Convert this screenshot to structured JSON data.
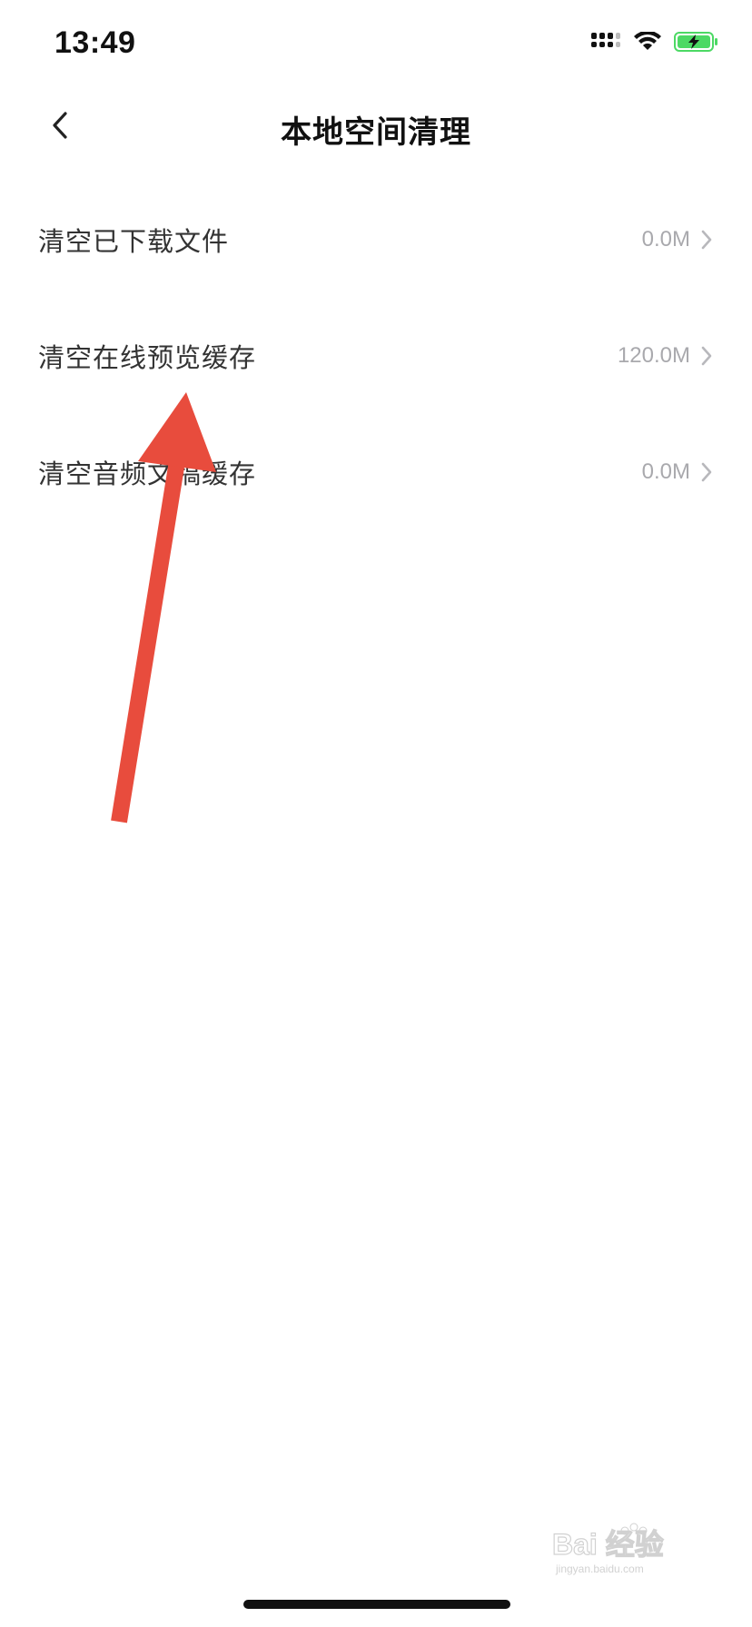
{
  "status_bar": {
    "time": "13:49",
    "icons": [
      "signal-icon",
      "wifi-icon",
      "battery-charging-icon"
    ],
    "battery_color": "#4cd964"
  },
  "nav": {
    "back_icon": "chevron-left-icon",
    "title": "本地空间清理"
  },
  "items": [
    {
      "label": "清空已下载文件",
      "value": "0.0M"
    },
    {
      "label": "清空在线预览缓存",
      "value": "120.0M"
    },
    {
      "label": "清空音频文稿缓存",
      "value": "0.0M"
    }
  ],
  "annotation": {
    "icon": "red-arrow-annotation",
    "color": "#e84c3d"
  },
  "watermark": {
    "icon": "baidu-jingyan-watermark",
    "text": "Bai 经验",
    "url_text": "jingyan.baidu.com"
  },
  "colors": {
    "value_gray": "#a9a9ad",
    "chevron_gray": "#b8b8bc"
  }
}
